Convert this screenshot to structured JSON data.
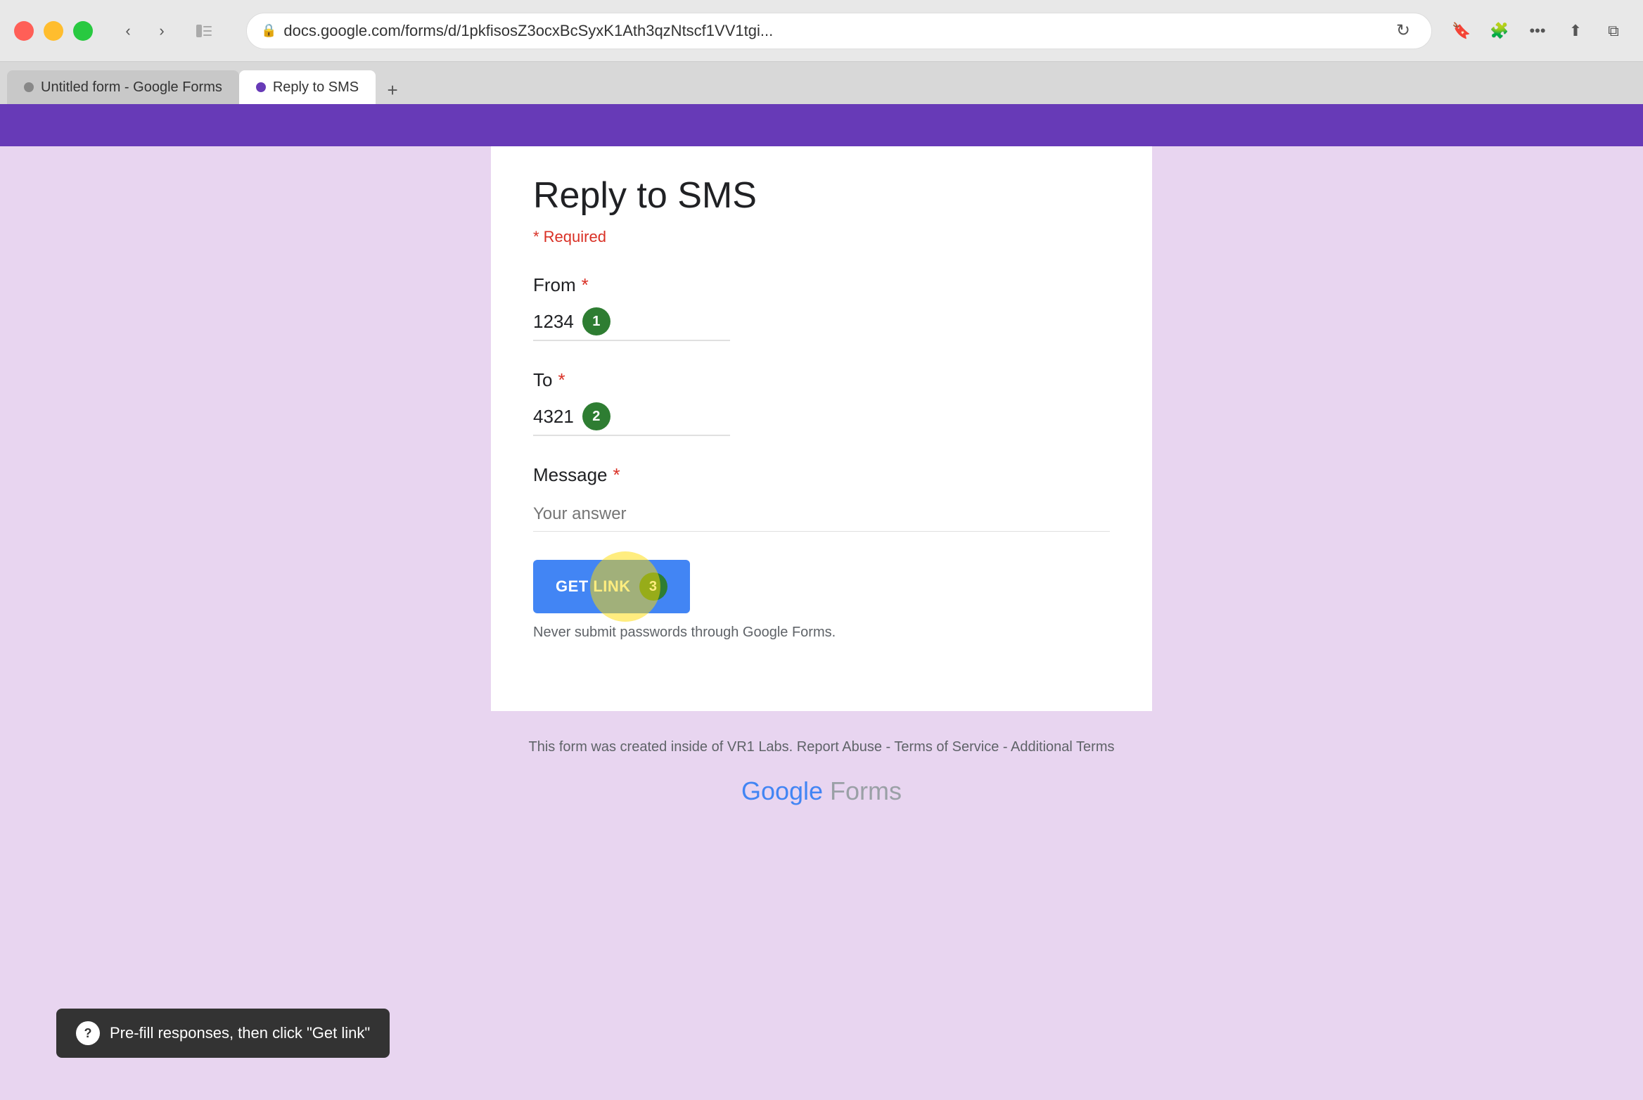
{
  "browser": {
    "url": "docs.google.com/forms/d/1pkfisosZ3ocxBcSyxK1Ath3qzNtscf1VV1tgi...",
    "tabs": [
      {
        "label": "Untitled form - Google Forms",
        "active": false
      },
      {
        "label": "Reply to SMS",
        "active": true
      }
    ],
    "new_tab_label": "+"
  },
  "page": {
    "title": "Reply to SMS",
    "required_note": "* Required",
    "fields": [
      {
        "label": "From",
        "required": true,
        "value": "1234",
        "badge": "1"
      },
      {
        "label": "To",
        "required": true,
        "value": "4321",
        "badge": "2"
      },
      {
        "label": "Message",
        "required": true,
        "placeholder": "Your answer"
      }
    ],
    "get_link_button": "GET LINK",
    "get_link_badge": "3",
    "never_submit_text": "Never submit passwords through Google Forms.",
    "footer": {
      "text": "This form was created inside of VR1 Labs. Report Abuse - Terms of Service - Additional Terms",
      "logo": "Google Forms"
    },
    "tooltip": {
      "text": "Pre-fill responses, then click \"Get link\"",
      "icon": "?"
    }
  }
}
